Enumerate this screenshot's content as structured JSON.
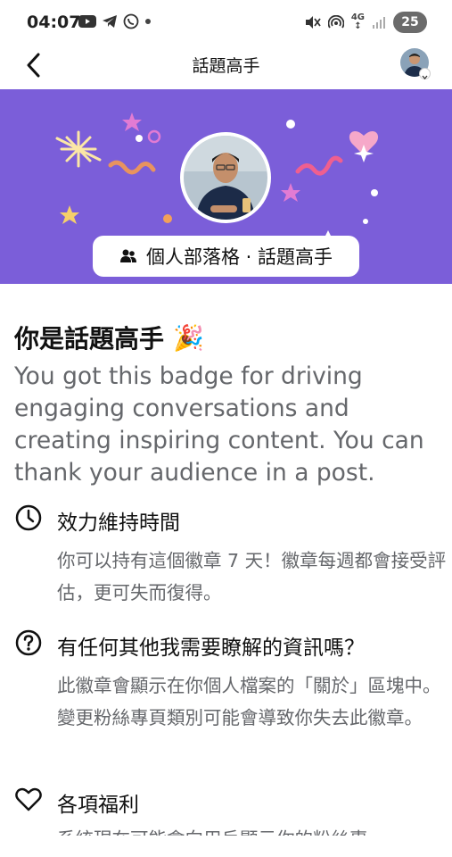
{
  "status_bar": {
    "time": "04:07",
    "network": "4G",
    "battery": "25"
  },
  "nav": {
    "title": "話題高手"
  },
  "banner": {
    "background": "#7b5ed9",
    "badge_label": "個人部落格 · 話題高手"
  },
  "content": {
    "headline": "你是話題高手",
    "headline_emoji": "🎉",
    "description": "You got this badge for driving engaging conversations and creating inspiring content. You can thank your audience in a post."
  },
  "sections": [
    {
      "icon": "clock-icon",
      "title": "效力維持時間",
      "body": "你可以持有這個徽章 7 天！徽章每週都會接受評估，更可失而復得。"
    },
    {
      "icon": "question-icon",
      "title": "有任何其他我需要瞭解的資訊嗎？",
      "body": "此徽章會顯示在你個人檔案的「關於」區塊中。變更粉絲專頁類別可能會導致你失去此徽章。"
    },
    {
      "icon": "heart-icon",
      "title": "各項福利",
      "body": "系統現在可能會向用戶顯示你的粉絲專"
    }
  ]
}
